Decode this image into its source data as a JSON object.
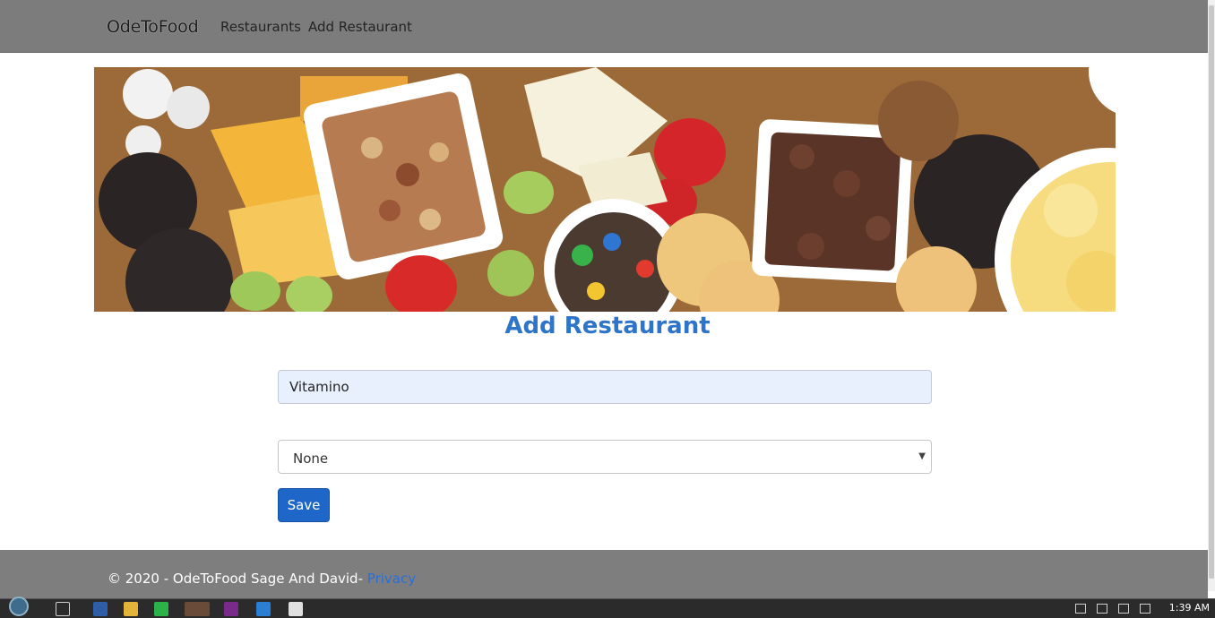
{
  "navbar": {
    "brand": "OdeToFood",
    "links": [
      "Restaurants",
      "Add Restaurant"
    ]
  },
  "main": {
    "title": "Add Restaurant",
    "name_value": "Vitamino",
    "cuisine_selected": "None",
    "save_label": "Save"
  },
  "footer": {
    "text": "© 2020 - OdeToFood Sage And David-",
    "privacy_label": "Privacy"
  },
  "taskbar": {
    "clock": "1:39 AM"
  },
  "colors": {
    "navbar": "#7c7c7c",
    "accent": "#2e74c9",
    "button": "#1e66c7",
    "footer": "#7e7e7e"
  }
}
